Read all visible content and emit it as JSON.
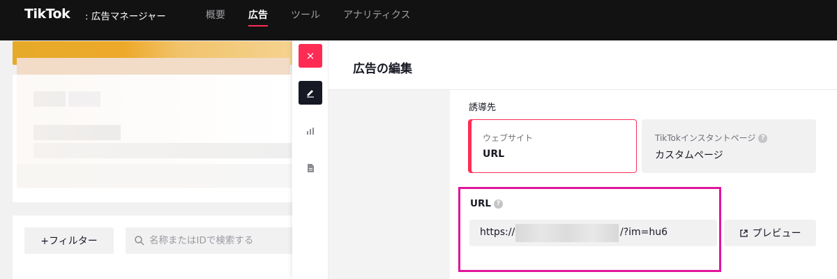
{
  "topbar": {
    "logo": "TikTok",
    "logo_sub": ": 広告マネージャー",
    "nav": [
      "概要",
      "広告",
      "ツール",
      "アナリティクス"
    ],
    "active_nav": "広告"
  },
  "filter": {
    "add_filter_label": "+フィルター",
    "search_placeholder": "名称またはIDで検索する"
  },
  "drawer": {
    "close_label": "×",
    "title": "広告の編集",
    "destination_label": "誘導先",
    "destinations": [
      {
        "small": "ウェブサイト",
        "big": "URL",
        "selected": true
      },
      {
        "small": "TikTokインスタントページ",
        "big": "カスタムページ",
        "selected": false
      }
    ],
    "url": {
      "label": "URL",
      "prefix": "https://",
      "suffix": "/?im=hu6"
    },
    "preview_label": "プレビュー"
  },
  "colors": {
    "accent": "#fe2c55",
    "highlight": "#e0159c",
    "topbar": "#121212"
  }
}
